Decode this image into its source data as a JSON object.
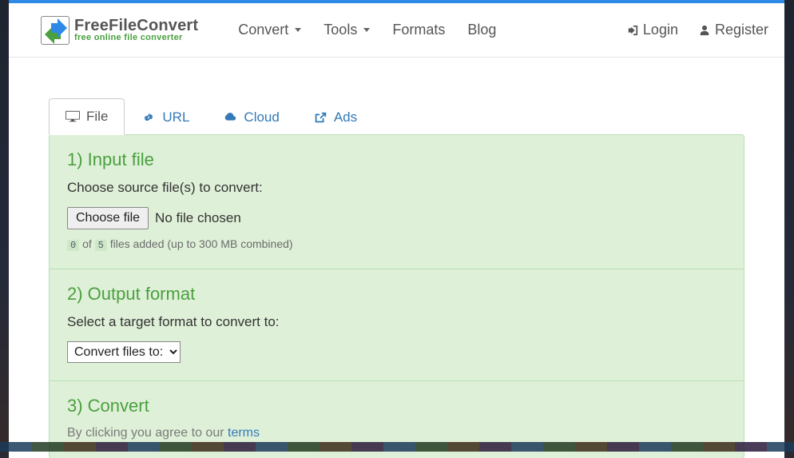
{
  "brand": {
    "name": "FreeFileConvert",
    "tagline": "free online file converter"
  },
  "nav": {
    "left": [
      {
        "label": "Convert",
        "caret": true
      },
      {
        "label": "Tools",
        "caret": true
      },
      {
        "label": "Formats",
        "caret": false
      },
      {
        "label": "Blog",
        "caret": false
      }
    ],
    "right": [
      {
        "label": "Login",
        "icon": "signin"
      },
      {
        "label": "Register",
        "icon": "user"
      }
    ]
  },
  "tabs": [
    {
      "label": "File",
      "icon": "desktop",
      "active": true
    },
    {
      "label": "URL",
      "icon": "link",
      "active": false
    },
    {
      "label": "Cloud",
      "icon": "cloud",
      "active": false
    },
    {
      "label": "Ads",
      "icon": "external",
      "active": false
    }
  ],
  "sections": {
    "input": {
      "title": "1) Input file",
      "lead": "Choose source file(s) to convert:",
      "choose_button": "Choose file",
      "no_file": "No file chosen",
      "hint_current": "0",
      "hint_of": "of",
      "hint_max": "5",
      "hint_rest": "files added (up to 300 MB combined)"
    },
    "output": {
      "title": "2) Output format",
      "lead": "Select a target format to convert to:",
      "select_label": "Convert files to:"
    },
    "convert": {
      "title": "3) Convert",
      "terms_prefix": "By clicking you agree to our ",
      "terms_link": "terms"
    }
  }
}
